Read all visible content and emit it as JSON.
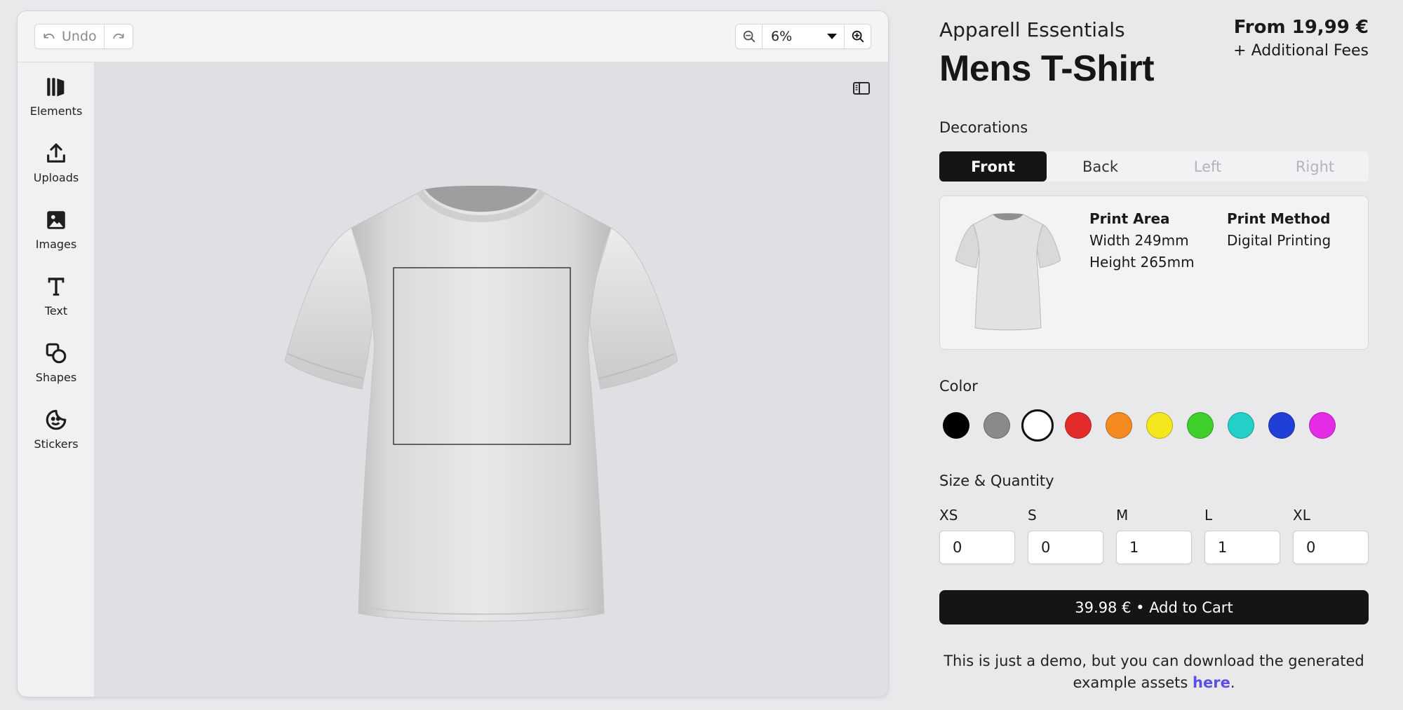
{
  "editor": {
    "toolbar": {
      "undo_label": "Undo",
      "zoom_value": "6%"
    },
    "sidebar": {
      "items": [
        {
          "label": "Elements",
          "icon": "elements-icon"
        },
        {
          "label": "Uploads",
          "icon": "upload-icon"
        },
        {
          "label": "Images",
          "icon": "image-icon"
        },
        {
          "label": "Text",
          "icon": "text-icon"
        },
        {
          "label": "Shapes",
          "icon": "shapes-icon"
        },
        {
          "label": "Stickers",
          "icon": "sticker-icon"
        }
      ]
    }
  },
  "product": {
    "brand": "Apparell Essentials",
    "title": "Mens T-Shirt",
    "price": "From 19,99 €",
    "fees": "+ Additional Fees"
  },
  "decorations": {
    "label": "Decorations",
    "tabs": [
      {
        "label": "Front",
        "state": "active"
      },
      {
        "label": "Back",
        "state": "normal"
      },
      {
        "label": "Left",
        "state": "disabled"
      },
      {
        "label": "Right",
        "state": "disabled"
      }
    ],
    "print_area": {
      "heading": "Print Area",
      "width": "Width 249mm",
      "height": "Height 265mm"
    },
    "print_method": {
      "heading": "Print Method",
      "value": "Digital Printing"
    }
  },
  "color": {
    "label": "Color",
    "swatches": [
      "#000000",
      "#8a8a8a",
      "#ffffff",
      "#e32b2b",
      "#f58a21",
      "#f6e61d",
      "#3ecf2a",
      "#22d0c8",
      "#1f3fd6",
      "#e62be6"
    ],
    "selected_index": 2
  },
  "size_quantity": {
    "label": "Size & Quantity",
    "sizes": [
      {
        "size": "XS",
        "qty": "0"
      },
      {
        "size": "S",
        "qty": "0"
      },
      {
        "size": "M",
        "qty": "1"
      },
      {
        "size": "L",
        "qty": "1"
      },
      {
        "size": "XL",
        "qty": "0"
      }
    ]
  },
  "cart": {
    "button_label": "39.98 € • Add to Cart"
  },
  "note": {
    "text_before": "This is just a demo, but you can download the generated example assets ",
    "link_text": "here",
    "text_after": "."
  }
}
